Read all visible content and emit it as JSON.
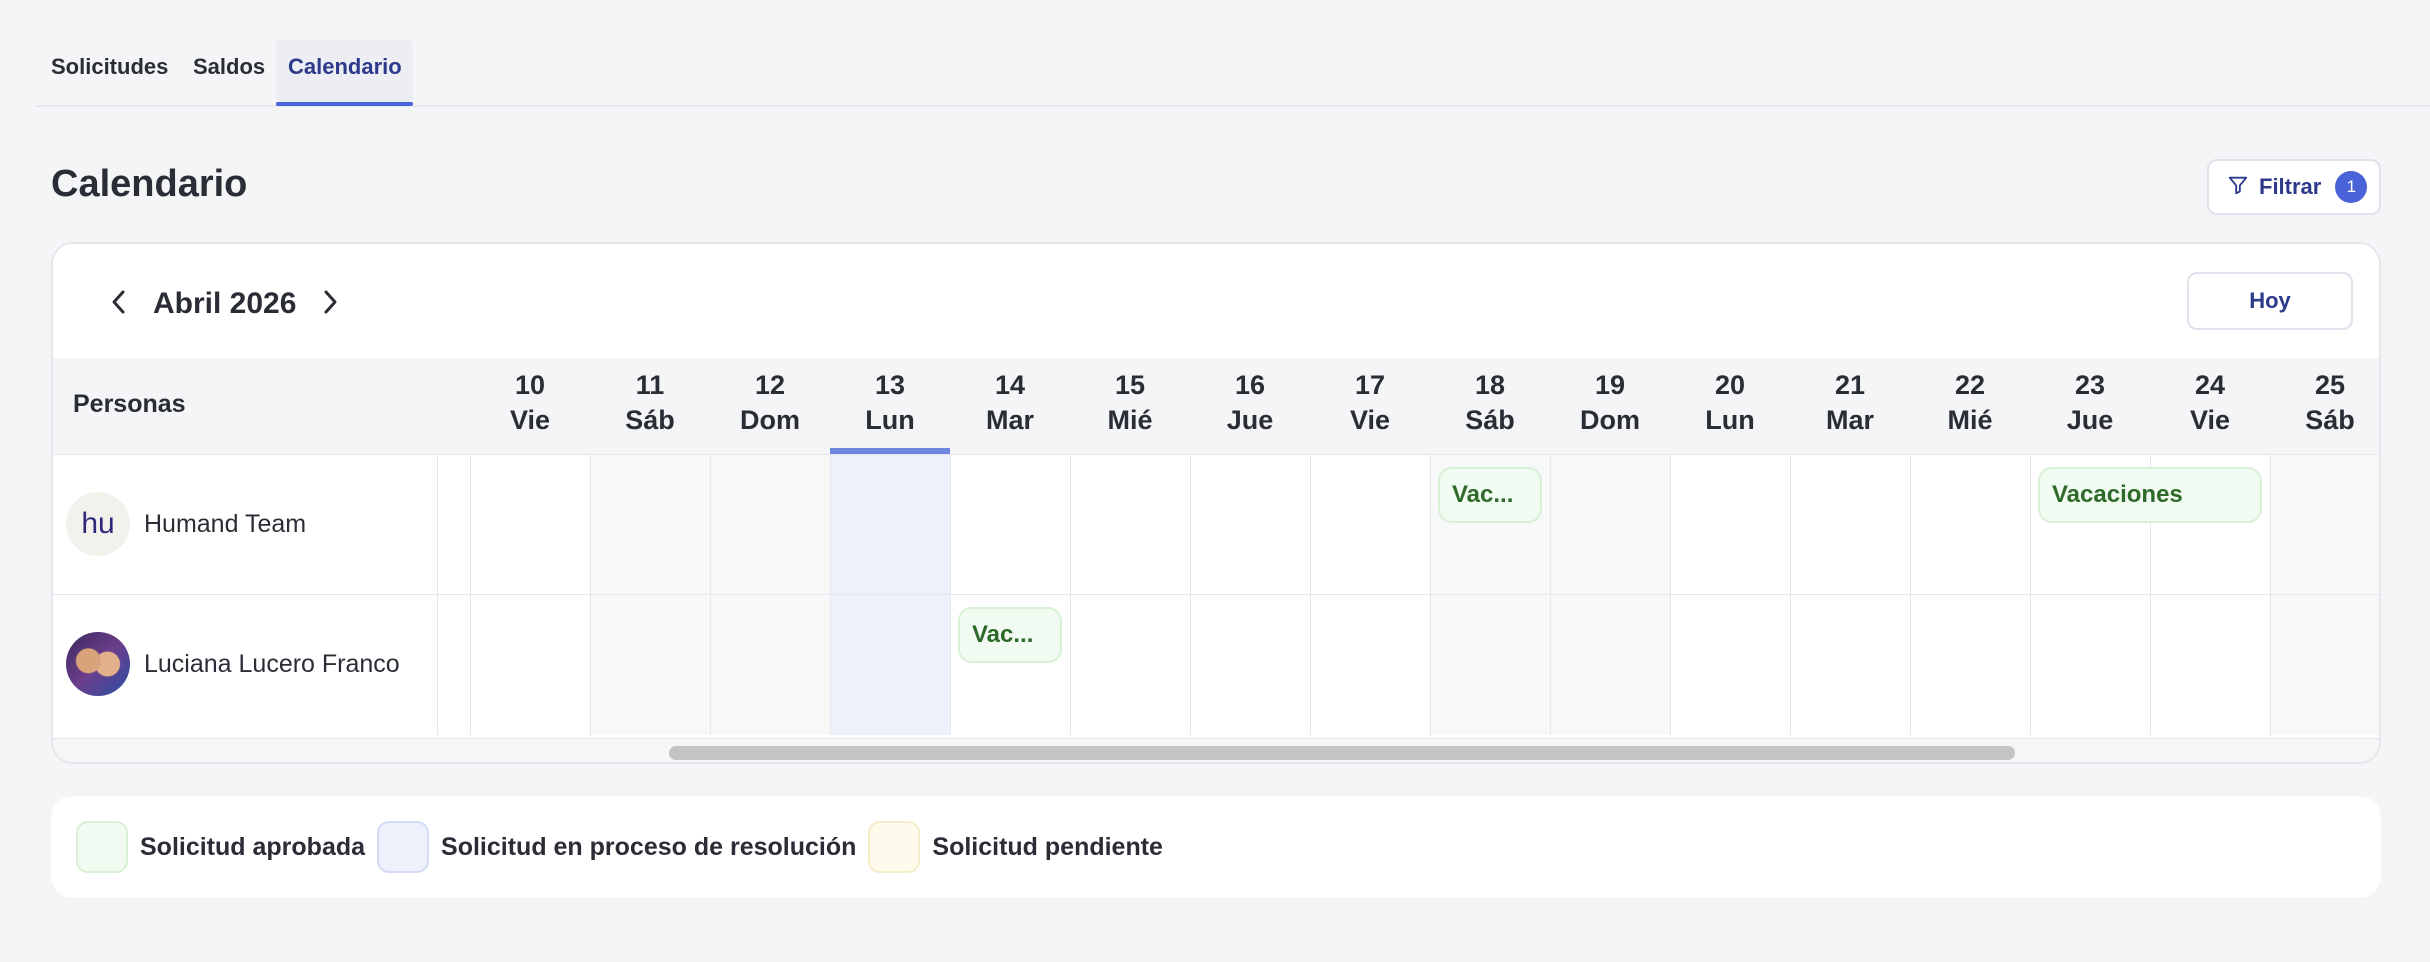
{
  "tabs": [
    {
      "label": "Solicitudes"
    },
    {
      "label": "Saldos"
    },
    {
      "label": "Calendario",
      "active": true
    }
  ],
  "page": {
    "title": "Calendario"
  },
  "filter": {
    "label": "Filtrar",
    "count": "1"
  },
  "calendar": {
    "month_label": "Abril 2026",
    "today_label": "Hoy",
    "persons_header": "Personas",
    "days": [
      {
        "num": "10",
        "name": "Vie"
      },
      {
        "num": "11",
        "name": "Sáb"
      },
      {
        "num": "12",
        "name": "Dom"
      },
      {
        "num": "13",
        "name": "Lun",
        "today": true
      },
      {
        "num": "14",
        "name": "Mar"
      },
      {
        "num": "15",
        "name": "Mié"
      },
      {
        "num": "16",
        "name": "Jue"
      },
      {
        "num": "17",
        "name": "Vie"
      },
      {
        "num": "18",
        "name": "Sáb"
      },
      {
        "num": "19",
        "name": "Dom"
      },
      {
        "num": "20",
        "name": "Lun"
      },
      {
        "num": "21",
        "name": "Mar"
      },
      {
        "num": "22",
        "name": "Mié"
      },
      {
        "num": "23",
        "name": "Jue"
      },
      {
        "num": "24",
        "name": "Vie"
      },
      {
        "num": "25",
        "name": "Sáb"
      }
    ],
    "people": [
      {
        "name": "Humand Team",
        "avatar_text": "hu",
        "events": [
          {
            "label": "Vac...",
            "day_index": 8,
            "span": 1,
            "status": "approved"
          },
          {
            "label": "Vacaciones",
            "day_index": 13,
            "span": 2,
            "status": "approved"
          }
        ]
      },
      {
        "name": "Luciana Lucero Franco",
        "avatar_text": "",
        "events": [
          {
            "label": "Vac...",
            "day_index": 4,
            "span": 1,
            "status": "approved"
          }
        ]
      }
    ]
  },
  "legend": [
    {
      "label": "Solicitud aprobada",
      "fill": "#f2fbf1",
      "border": "#d8f0d5"
    },
    {
      "label": "Solicitud en proceso de resolución",
      "fill": "#eef1fb",
      "border": "#d3dbf5"
    },
    {
      "label": "Solicitud pendiente",
      "fill": "#fffbec",
      "border": "#f5ecc8"
    }
  ],
  "colors": {
    "accent": "#4a63d8",
    "brand_text": "#2d3a8c",
    "approved_text": "#2e6a2a"
  }
}
